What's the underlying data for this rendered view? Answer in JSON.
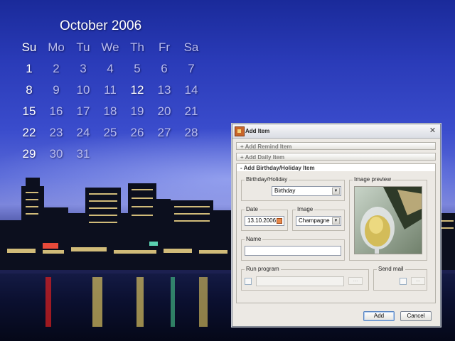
{
  "calendar": {
    "title": "October 2006",
    "weekdays": [
      "Su",
      "Mo",
      "Tu",
      "We",
      "Th",
      "Fr",
      "Sa"
    ],
    "weeks": [
      [
        "1",
        "2",
        "3",
        "4",
        "5",
        "6",
        "7"
      ],
      [
        "8",
        "9",
        "10",
        "11",
        "12",
        "13",
        "14"
      ],
      [
        "15",
        "16",
        "17",
        "18",
        "19",
        "20",
        "21"
      ],
      [
        "22",
        "23",
        "24",
        "25",
        "26",
        "27",
        "28"
      ],
      [
        "29",
        "30",
        "31",
        "",
        "",
        "",
        ""
      ]
    ],
    "highlighted_day": "12"
  },
  "dialog": {
    "title": "Add Item",
    "close_icon": "close-icon",
    "sections": {
      "remind": "+ Add Remind Item",
      "daily": "+ Add Daily Item",
      "birthday": "- Add Birthday/Holiday Item"
    },
    "birthday_holiday": {
      "label": "Birthday/Holiday",
      "value": "Birthday"
    },
    "image_preview": {
      "label": "Image preview"
    },
    "date": {
      "label": "Date",
      "value": "13.10.2006"
    },
    "image": {
      "label": "Image",
      "value": "Champagne"
    },
    "name": {
      "label": "Name",
      "value": ""
    },
    "run_program": {
      "label": "Run program",
      "browse": "...."
    },
    "send_mail": {
      "label": "Send mail",
      "browse": "...."
    },
    "buttons": {
      "add": "Add",
      "cancel": "Cancel"
    }
  },
  "colors": {
    "sky_top": "#1a2a9a",
    "sky_mid": "#5a6ad8",
    "dialog_bg": "#ece9e4",
    "default_button_border": "#5a86c2"
  }
}
